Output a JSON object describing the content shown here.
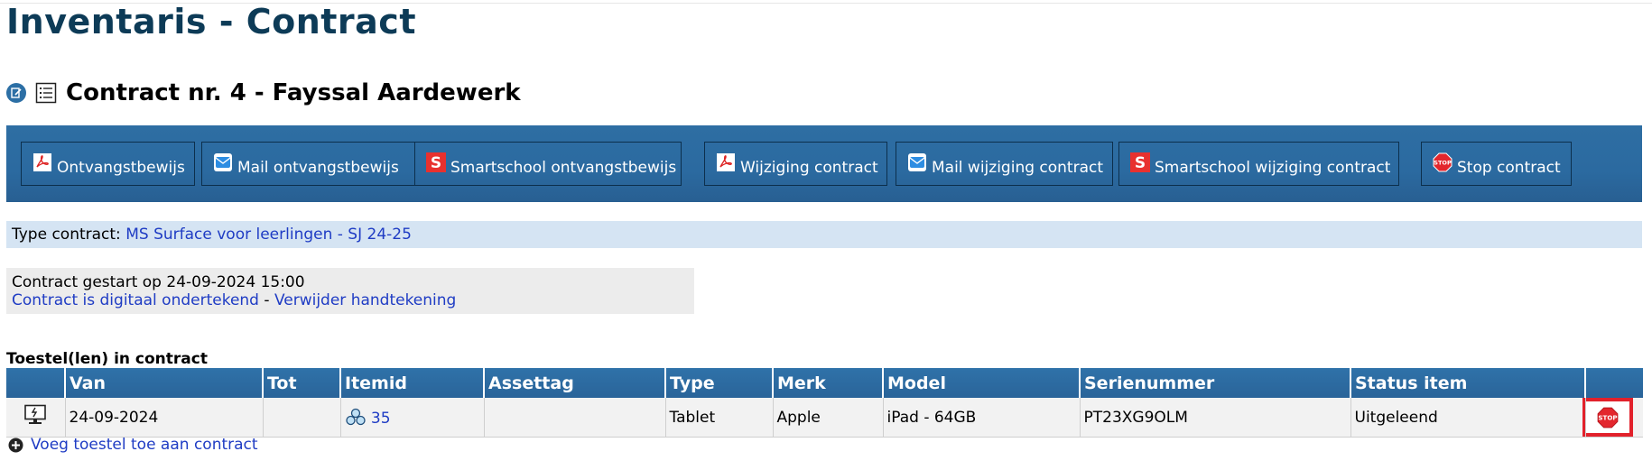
{
  "page": {
    "title": "Inventaris - Contract"
  },
  "contract": {
    "title": "Contract nr. 4 - Fayssal Aardewerk"
  },
  "toolbar": {
    "buttons": [
      {
        "label": "Ontvangstbewijs",
        "icon": "pdf-icon"
      },
      {
        "label": "Mail ontvangstbewijs",
        "icon": "mail-icon"
      },
      {
        "label": "Smartschool ontvangstbewijs",
        "icon": "smartschool-icon"
      },
      {
        "label": "Wijziging contract",
        "icon": "pdf-icon"
      },
      {
        "label": "Mail wijziging contract",
        "icon": "mail-icon"
      },
      {
        "label": "Smartschool wijziging contract",
        "icon": "smartschool-icon"
      },
      {
        "label": "Stop contract",
        "icon": "stop-icon"
      }
    ]
  },
  "type_contract": {
    "label": "Type contract:",
    "value": "MS Surface voor leerlingen - SJ 24-25"
  },
  "contract_info": {
    "started": "Contract gestart op 24-09-2024 15:00",
    "signed_link": "Contract is digitaal ondertekend",
    "separator": "-",
    "remove_signature_link": "Verwijder handtekening"
  },
  "devices": {
    "title": "Toestel(len) in contract",
    "columns": [
      "",
      "Van",
      "Tot",
      "Itemid",
      "Assettag",
      "Type",
      "Merk",
      "Model",
      "Serienummer",
      "Status item",
      ""
    ],
    "rows": [
      {
        "van": "24-09-2024",
        "tot": "",
        "itemid": "35",
        "assettag": "",
        "type": "Tablet",
        "merk": "Apple",
        "model": "iPad - 64GB",
        "serienummer": "PT23XG9OLM",
        "status": "Uitgeleend"
      }
    ]
  },
  "add_device": {
    "label": "Voeg toestel toe aan contract"
  },
  "colors": {
    "accent": "#2b6aa0",
    "title": "#0d3b57",
    "link": "#1f3cc4",
    "highlight": "#e2212b"
  }
}
